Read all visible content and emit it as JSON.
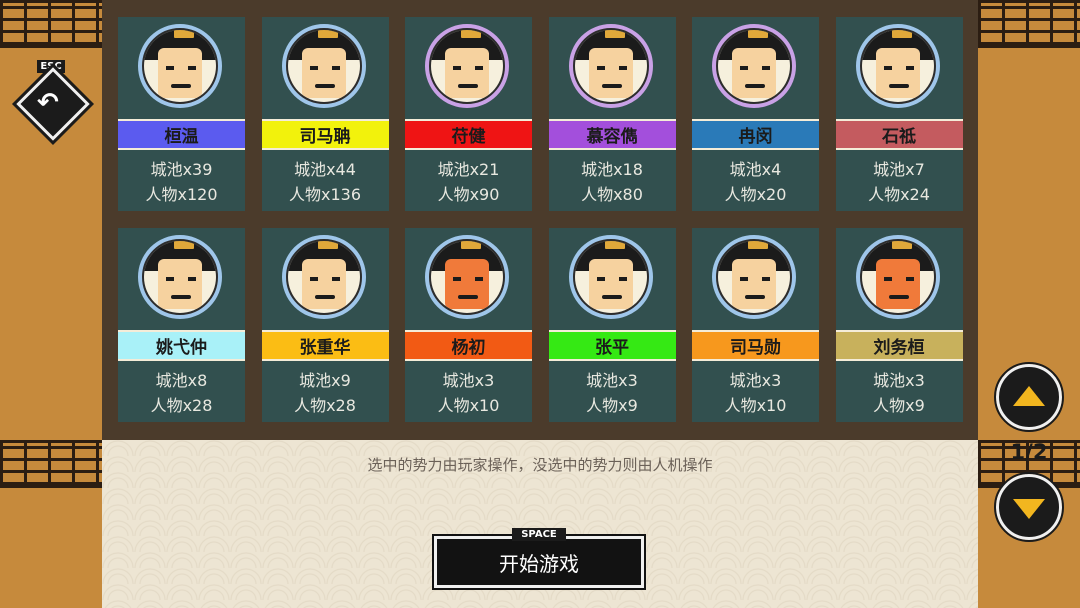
{
  "esc_label": "ESC",
  "factions": [
    {
      "name": "桓温",
      "color": "#5b5bef",
      "cities": "城池x39",
      "people": "人物x120",
      "ring": "#9fc6ea",
      "face": "#f6d29f"
    },
    {
      "name": "司马聃",
      "color": "#f2f20c",
      "cities": "城池x44",
      "people": "人物x136",
      "ring": "#9fc6ea",
      "face": "#f6d29f"
    },
    {
      "name": "苻健",
      "color": "#ef1414",
      "cities": "城池x21",
      "people": "人物x90",
      "ring": "#c9a1e6",
      "face": "#f6d29f"
    },
    {
      "name": "慕容儁",
      "color": "#a34fdc",
      "cities": "城池x18",
      "people": "人物x80",
      "ring": "#c9a1e6",
      "face": "#f6d29f"
    },
    {
      "name": "冉闵",
      "color": "#2a7ab8",
      "cities": "城池x4",
      "people": "人物x20",
      "ring": "#c9a1e6",
      "face": "#f6d29f"
    },
    {
      "name": "石祗",
      "color": "#c45b5f",
      "cities": "城池x7",
      "people": "人物x24",
      "ring": "#9fc6ea",
      "face": "#f6d29f"
    },
    {
      "name": "姚弋仲",
      "color": "#a9f1f8",
      "cities": "城池x8",
      "people": "人物x28",
      "ring": "#9fc6ea",
      "face": "#f6d29f"
    },
    {
      "name": "张重华",
      "color": "#fbbd14",
      "cities": "城池x9",
      "people": "人物x28",
      "ring": "#9fc6ea",
      "face": "#f6d29f"
    },
    {
      "name": "杨初",
      "color": "#f25a14",
      "cities": "城池x3",
      "people": "人物x10",
      "ring": "#9fc6ea",
      "face": "#f07a3a"
    },
    {
      "name": "张平",
      "color": "#35e914",
      "cities": "城池x3",
      "people": "人物x9",
      "ring": "#9fc6ea",
      "face": "#f6d29f"
    },
    {
      "name": "司马勋",
      "color": "#f7981d",
      "cities": "城池x3",
      "people": "人物x10",
      "ring": "#9fc6ea",
      "face": "#f6d29f"
    },
    {
      "name": "刘务桓",
      "color": "#c8b15c",
      "cities": "城池x3",
      "people": "人物x9",
      "ring": "#9fc6ea",
      "face": "#f07a3a"
    }
  ],
  "hint": "选中的势力由玩家操作，没选中的势力则由人机操作",
  "start_key": "SPACE",
  "start_label": "开始游戏",
  "page_indicator": "1/2"
}
